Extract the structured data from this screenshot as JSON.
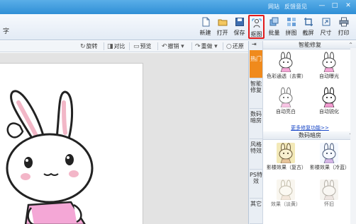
{
  "titlebar": {
    "links": [
      "网站",
      "反馈意见"
    ],
    "controls": [
      "—",
      "□",
      "✕"
    ]
  },
  "toolbar": {
    "ribbon_fragment": "字",
    "buttons": [
      {
        "label": "新建",
        "icon": "new-file-icon"
      },
      {
        "label": "打开",
        "icon": "open-folder-icon"
      },
      {
        "label": "保存",
        "icon": "save-disk-icon"
      },
      {
        "label": "抠图",
        "icon": "cutout-icon"
      },
      {
        "label": "批量",
        "icon": "batch-icon"
      },
      {
        "label": "拼图",
        "icon": "collage-icon"
      },
      {
        "label": "截屏",
        "icon": "screenshot-icon"
      },
      {
        "label": "尺寸",
        "icon": "resize-icon"
      },
      {
        "label": "打印",
        "icon": "print-icon"
      }
    ],
    "active": "抠图"
  },
  "edit_tools": [
    {
      "label": "旋转",
      "glyph": "↻"
    },
    {
      "label": "对比",
      "glyph": "◨"
    },
    {
      "label": "预览",
      "glyph": "▭"
    },
    {
      "label": "撤销",
      "glyph": "↶"
    },
    {
      "label": "重做",
      "glyph": "↷"
    },
    {
      "label": "还原",
      "glyph": "○"
    }
  ],
  "side_tabs": {
    "arrow": "⇥",
    "items": [
      "热门",
      "智能修复",
      "数码暗房",
      "风格特效",
      "PS特效",
      "其它"
    ],
    "active": "热门"
  },
  "panel": {
    "section1": {
      "title": "智能修复",
      "effects": [
        "色彩通透（去雾）",
        "自动曝光",
        "自动亮白",
        "自动锐化"
      ],
      "more_link": "更多修复功能>>"
    },
    "section2": {
      "title": "数码暗房",
      "effects": [
        "影楼效果（复古）",
        "影楼效果（冷蓝）",
        "效果（淡黄）",
        "怀旧"
      ]
    },
    "colors": {
      "accent": "#f08a1c",
      "highlight_border": "#e21b1b",
      "link": "#1545c7",
      "titlebar": "#2f8fd6"
    }
  }
}
